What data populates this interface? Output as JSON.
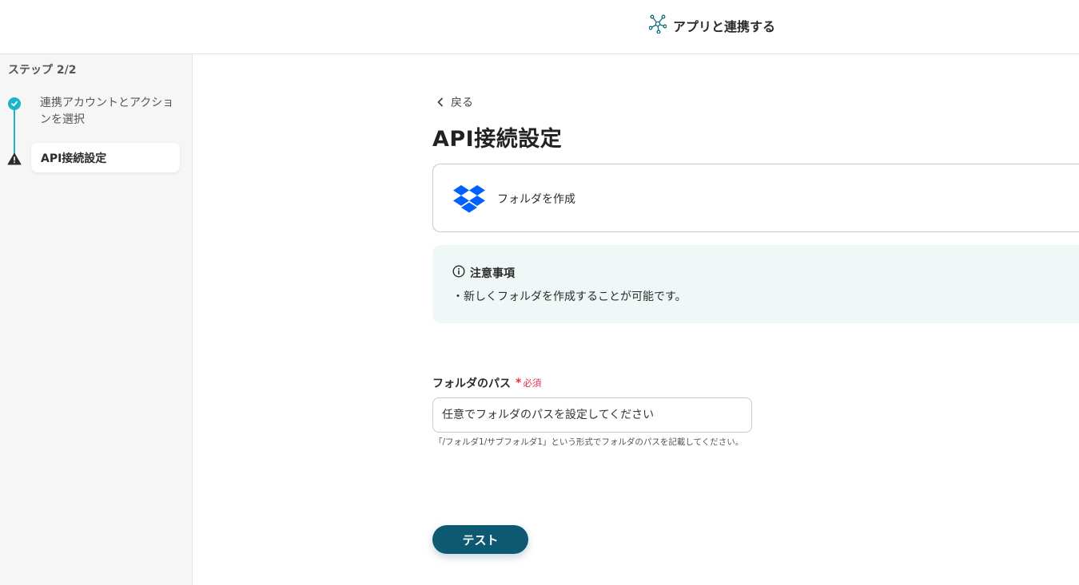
{
  "header": {
    "title": "アプリと連携する",
    "icon": "network-icon"
  },
  "sidebar": {
    "step_counter": "ステップ 2/2",
    "steps": [
      {
        "label": "連携アカウントとアクションを選択",
        "status": "completed",
        "icon": "check-circle-icon"
      },
      {
        "label": "API接続設定",
        "status": "warning",
        "icon": "warning-triangle-icon"
      }
    ]
  },
  "main": {
    "back_label": "戻る",
    "page_title": "API接続設定",
    "action": {
      "app_icon": "dropbox-logo",
      "name": "フォルダを作成"
    },
    "notice": {
      "title": "注意事項",
      "body": "・新しくフォルダを作成することが可能です。"
    },
    "path_field": {
      "label": "フォルダのパス",
      "required_label": "必須",
      "placeholder": "任意でフォルダのパスを設定してください",
      "help": "「/フォルダ1/サブフォルダ1」という形式でフォルダのパスを記載してください。"
    },
    "test_button_label": "テスト"
  },
  "colors": {
    "accent_teal": "#1ab6c8",
    "primary_button": "#0d5972",
    "required_red": "#e0304b",
    "notice_bg": "#eff7f7",
    "dropbox_blue": "#0061fe"
  }
}
